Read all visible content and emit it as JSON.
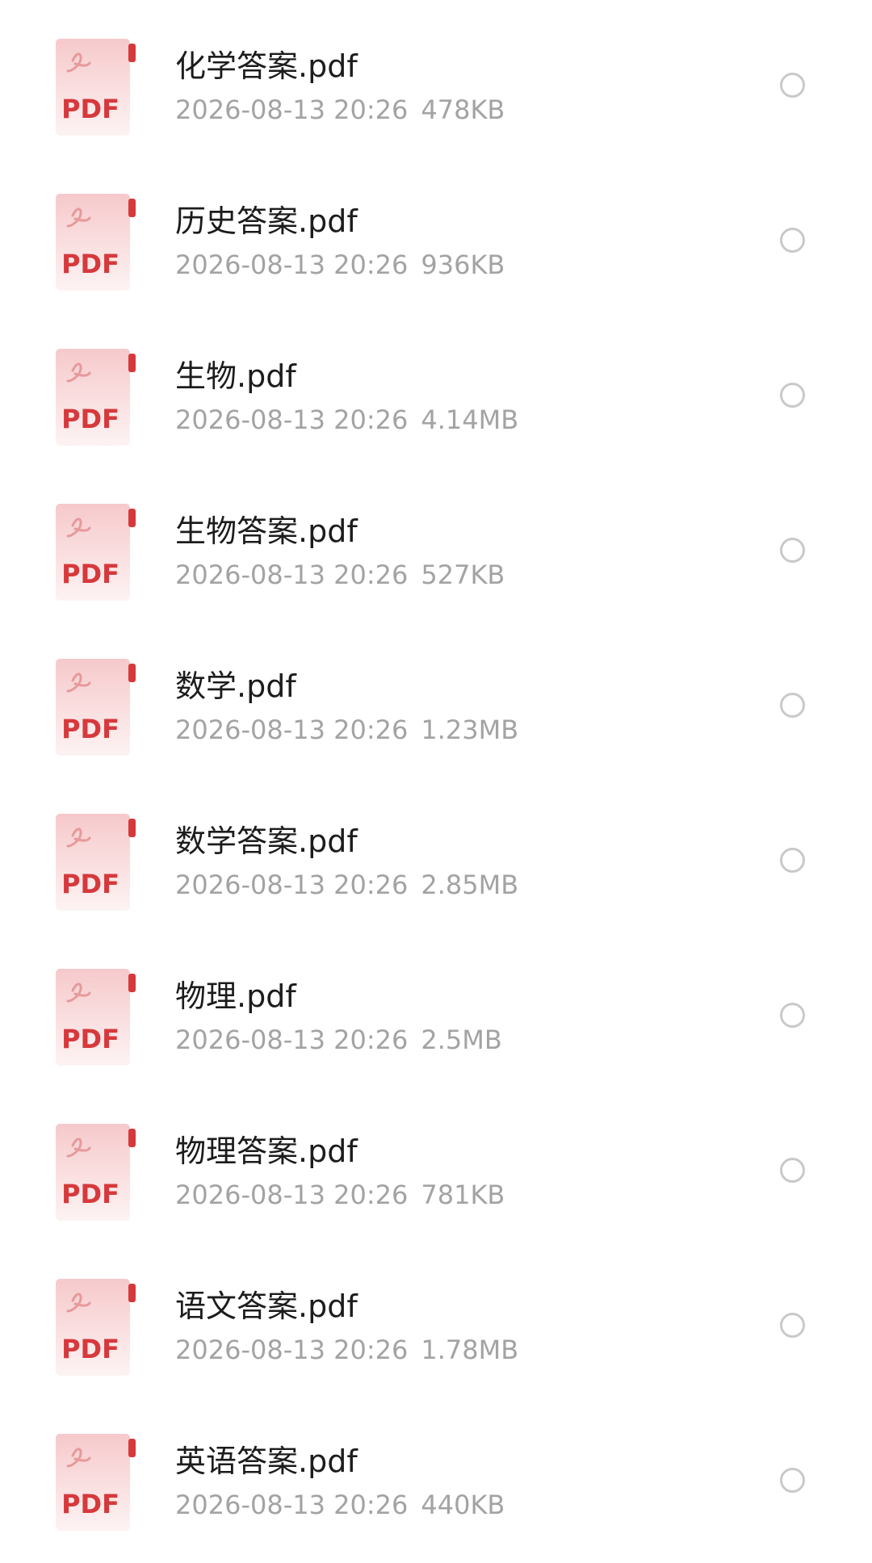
{
  "files": [
    {
      "icon": "pdf-file-icon",
      "icon_text": "PDF",
      "name": "化学答案.pdf",
      "date": "2026-08-13 20:26",
      "size": "478KB"
    },
    {
      "icon": "pdf-file-icon",
      "icon_text": "PDF",
      "name": "历史答案.pdf",
      "date": "2026-08-13 20:26",
      "size": "936KB"
    },
    {
      "icon": "pdf-file-icon",
      "icon_text": "PDF",
      "name": "生物.pdf",
      "date": "2026-08-13 20:26",
      "size": "4.14MB"
    },
    {
      "icon": "pdf-file-icon",
      "icon_text": "PDF",
      "name": "生物答案.pdf",
      "date": "2026-08-13 20:26",
      "size": "527KB"
    },
    {
      "icon": "pdf-file-icon",
      "icon_text": "PDF",
      "name": "数学.pdf",
      "date": "2026-08-13 20:26",
      "size": "1.23MB"
    },
    {
      "icon": "pdf-file-icon",
      "icon_text": "PDF",
      "name": "数学答案.pdf",
      "date": "2026-08-13 20:26",
      "size": "2.85MB"
    },
    {
      "icon": "pdf-file-icon",
      "icon_text": "PDF",
      "name": "物理.pdf",
      "date": "2026-08-13 20:26",
      "size": "2.5MB"
    },
    {
      "icon": "pdf-file-icon",
      "icon_text": "PDF",
      "name": "物理答案.pdf",
      "date": "2026-08-13 20:26",
      "size": "781KB"
    },
    {
      "icon": "pdf-file-icon",
      "icon_text": "PDF",
      "name": "语文答案.pdf",
      "date": "2026-08-13 20:26",
      "size": "1.78MB"
    },
    {
      "icon": "pdf-file-icon",
      "icon_text": "PDF",
      "name": "英语答案.pdf",
      "date": "2026-08-13 20:26",
      "size": "440KB"
    }
  ],
  "colors": {
    "pdf_red": "#d6393c",
    "icon_bg": "#fbe4e5",
    "name_text": "#1c1c1c",
    "meta_text": "#a3a3a3",
    "radio_border": "#c9c9c9"
  }
}
